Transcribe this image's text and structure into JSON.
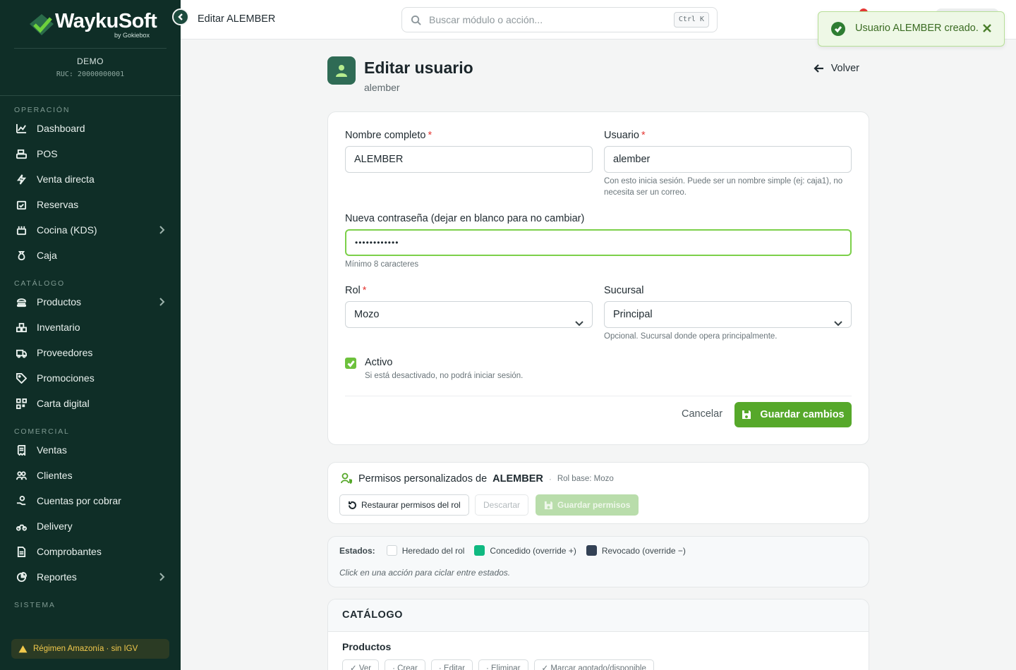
{
  "brand": {
    "name": "WaykuSoft",
    "sub": "by Gokiebox"
  },
  "company": {
    "name": "DEMO",
    "ruc": "RUC: 20000000001"
  },
  "nav": [
    {
      "section": "OPERACIÓN",
      "items": [
        {
          "label": "Dashboard",
          "icon": "chart-line-icon"
        },
        {
          "label": "POS",
          "icon": "cash-register-icon"
        },
        {
          "label": "Venta directa",
          "icon": "bolt-icon"
        },
        {
          "label": "Reservas",
          "icon": "calendar-check-icon"
        },
        {
          "label": "Cocina (KDS)",
          "icon": "kitchen-icon",
          "expand": true
        },
        {
          "label": "Caja",
          "icon": "money-bag-icon"
        }
      ]
    },
    {
      "section": "CATÁLOGO",
      "items": [
        {
          "label": "Productos",
          "icon": "burger-icon",
          "expand": true
        },
        {
          "label": "Inventario",
          "icon": "boxes-icon"
        },
        {
          "label": "Proveedores",
          "icon": "truck-icon"
        },
        {
          "label": "Promociones",
          "icon": "tags-icon"
        },
        {
          "label": "Carta digital",
          "icon": "qrcode-icon"
        }
      ]
    },
    {
      "section": "COMERCIAL",
      "items": [
        {
          "label": "Ventas",
          "icon": "receipt-icon"
        },
        {
          "label": "Clientes",
          "icon": "users-icon"
        },
        {
          "label": "Cuentas por cobrar",
          "icon": "hand-coin-icon"
        },
        {
          "label": "Delivery",
          "icon": "motorcycle-icon"
        },
        {
          "label": "Comprobantes",
          "icon": "file-icon"
        },
        {
          "label": "Reportes",
          "icon": "pie-chart-icon",
          "expand": true
        }
      ]
    },
    {
      "section": "SISTEMA",
      "items": []
    }
  ],
  "regimen": "Régimen Amazonía · sin IGV",
  "topbar": {
    "title": "Editar ALEMBER",
    "search_placeholder": "Buscar módulo o acción...",
    "shortcut": "Ctrl K"
  },
  "toast": {
    "message": "Usuario ALEMBER creado."
  },
  "page": {
    "title": "Editar usuario",
    "subtitle": "alember",
    "back": "Volver"
  },
  "form": {
    "fullname_label": "Nombre completo",
    "fullname_value": "ALEMBER",
    "username_label": "Usuario",
    "username_value": "alember",
    "username_hint": "Con esto inicia sesión. Puede ser un nombre simple (ej: caja1), no necesita ser un correo.",
    "password_label": "Nueva contraseña (dejar en blanco para no cambiar)",
    "password_value": "••••••••••••",
    "password_hint": "Mínimo 8 caracteres",
    "role_label": "Rol",
    "role_value": "Mozo",
    "branch_label": "Sucursal",
    "branch_value": "Principal",
    "branch_hint": "Opcional. Sucursal donde opera principalmente.",
    "active_label": "Activo",
    "active_checked": true,
    "active_hint": "Si está desactivado, no podrá iniciar sesión.",
    "required_mark": "*",
    "cancel": "Cancelar",
    "save": "Guardar cambios"
  },
  "permissions": {
    "title": "Permisos personalizados de",
    "user": "ALEMBER",
    "separator": "·",
    "role_base": "Rol base: Mozo",
    "restore": "Restaurar permisos del rol",
    "discard": "Descartar",
    "save": "Guardar permisos"
  },
  "legend": {
    "label": "Estados:",
    "items": [
      {
        "label": "Heredado del rol",
        "color": "#ffffff"
      },
      {
        "label": "Concedido (override +)",
        "color": "#10b981"
      },
      {
        "label": "Revocado (override −)",
        "color": "#334155"
      }
    ],
    "note": "Click en una acción para ciclar entre estados."
  },
  "catalog": {
    "title": "CATÁLOGO",
    "group": "Productos",
    "actions": [
      "✓ Ver",
      "· Crear",
      "· Editar",
      "· Eliminar",
      "✓ Marcar agotado/disponible"
    ]
  },
  "colors": {
    "sidebar": "#0f2e27",
    "accent": "#56a82a",
    "focus": "#7cd04a"
  }
}
